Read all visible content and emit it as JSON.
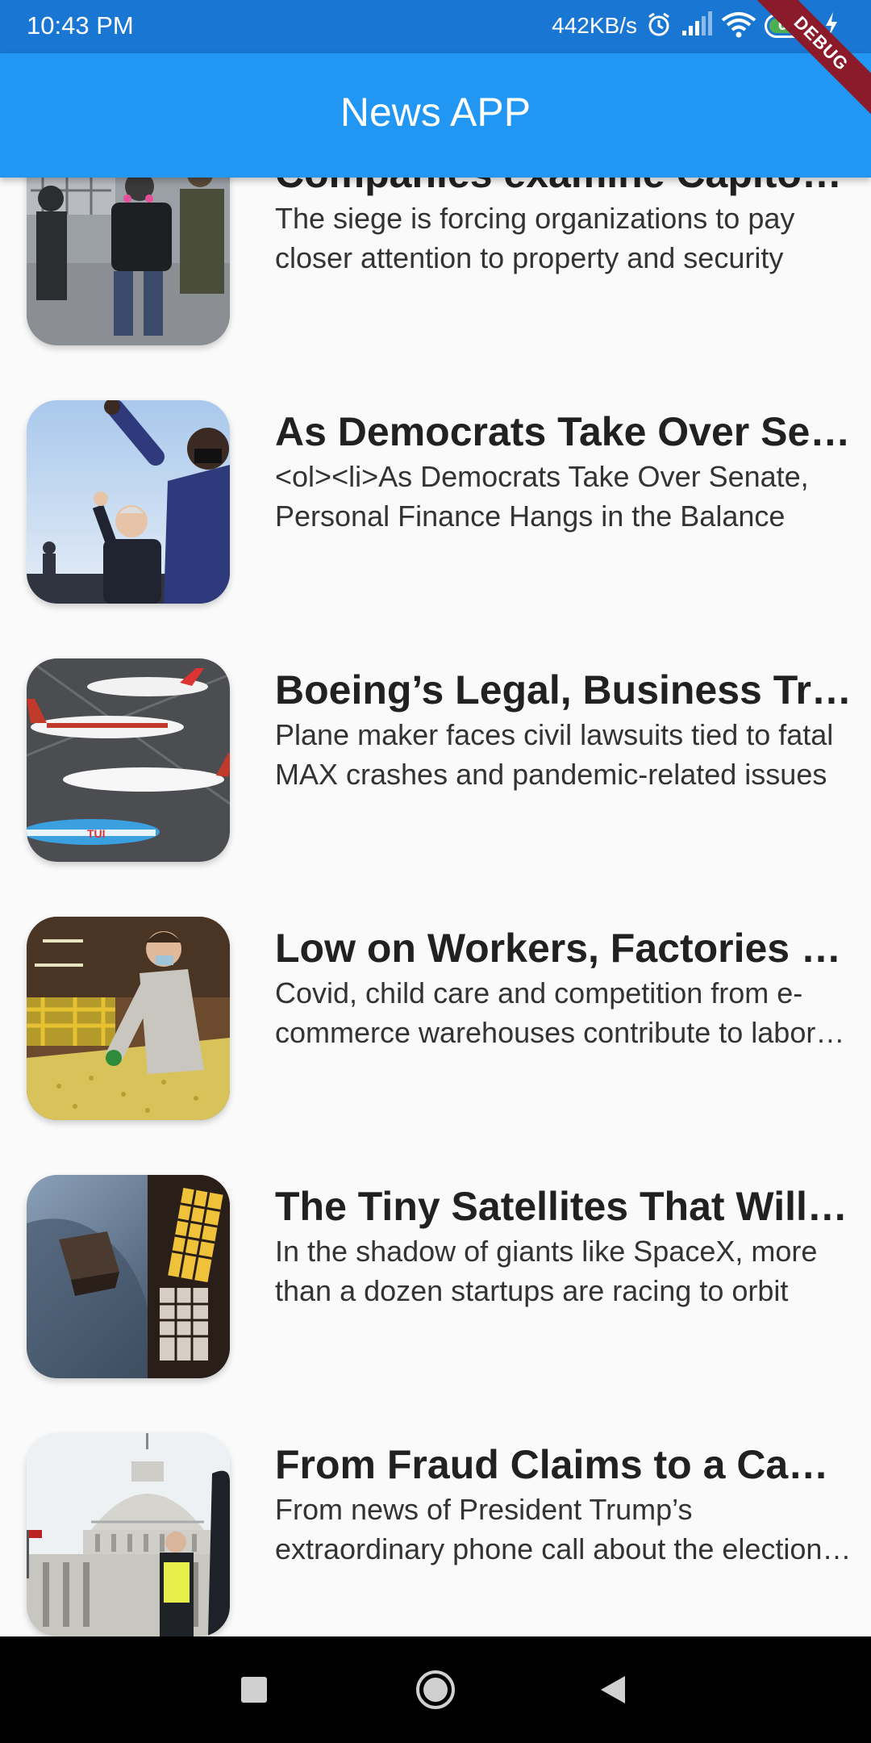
{
  "status_bar": {
    "time": "10:43 PM",
    "net_speed": "442KB/s",
    "battery": "61",
    "icons": [
      "alarm-icon",
      "signal-icon",
      "wifi-icon",
      "battery-icon",
      "charging-icon"
    ]
  },
  "app_bar": {
    "title": "News APP"
  },
  "debug_banner": "DEBUG",
  "articles": [
    {
      "title": "Companies examine Capitol Attack",
      "description": "The siege is forcing organizations to pay closer attention to property and security",
      "thumb": "protest-photo"
    },
    {
      "title": "As Democrats Take Over Senate",
      "description": "<ol><li>As Democrats Take Over Senate, Personal Finance Hangs in the Balance",
      "thumb": "politician-wave-photo"
    },
    {
      "title": "Boeing’s Legal, Business Troubles",
      "description": "Plane maker faces civil lawsuits tied to fatal MAX crashes and pandemic-related issues",
      "thumb": "airplanes-photo"
    },
    {
      "title": "Low on Workers, Factories Struggle",
      "description": "Covid, child care and competition from e-commerce warehouses contribute to labor shortage",
      "thumb": "factory-worker-photo"
    },
    {
      "title": "The Tiny Satellites That Will Change Everything",
      "description": "In the shadow of giants like SpaceX, more than a dozen startups are racing to orbit",
      "thumb": "satellite-photo"
    },
    {
      "title": "From Fraud Claims to a Capitol Riot",
      "description": "From news of President Trump’s extraordinary phone call about the election results",
      "thumb": "capitol-photo"
    }
  ],
  "nav_bar": {
    "icons": [
      "recents-square-icon",
      "home-circle-icon",
      "back-triangle-icon"
    ]
  },
  "colors": {
    "status_bar": "#1976D2",
    "app_bar": "#2196F3",
    "background": "#FAFAFA",
    "debug": "#8B1A2B"
  }
}
